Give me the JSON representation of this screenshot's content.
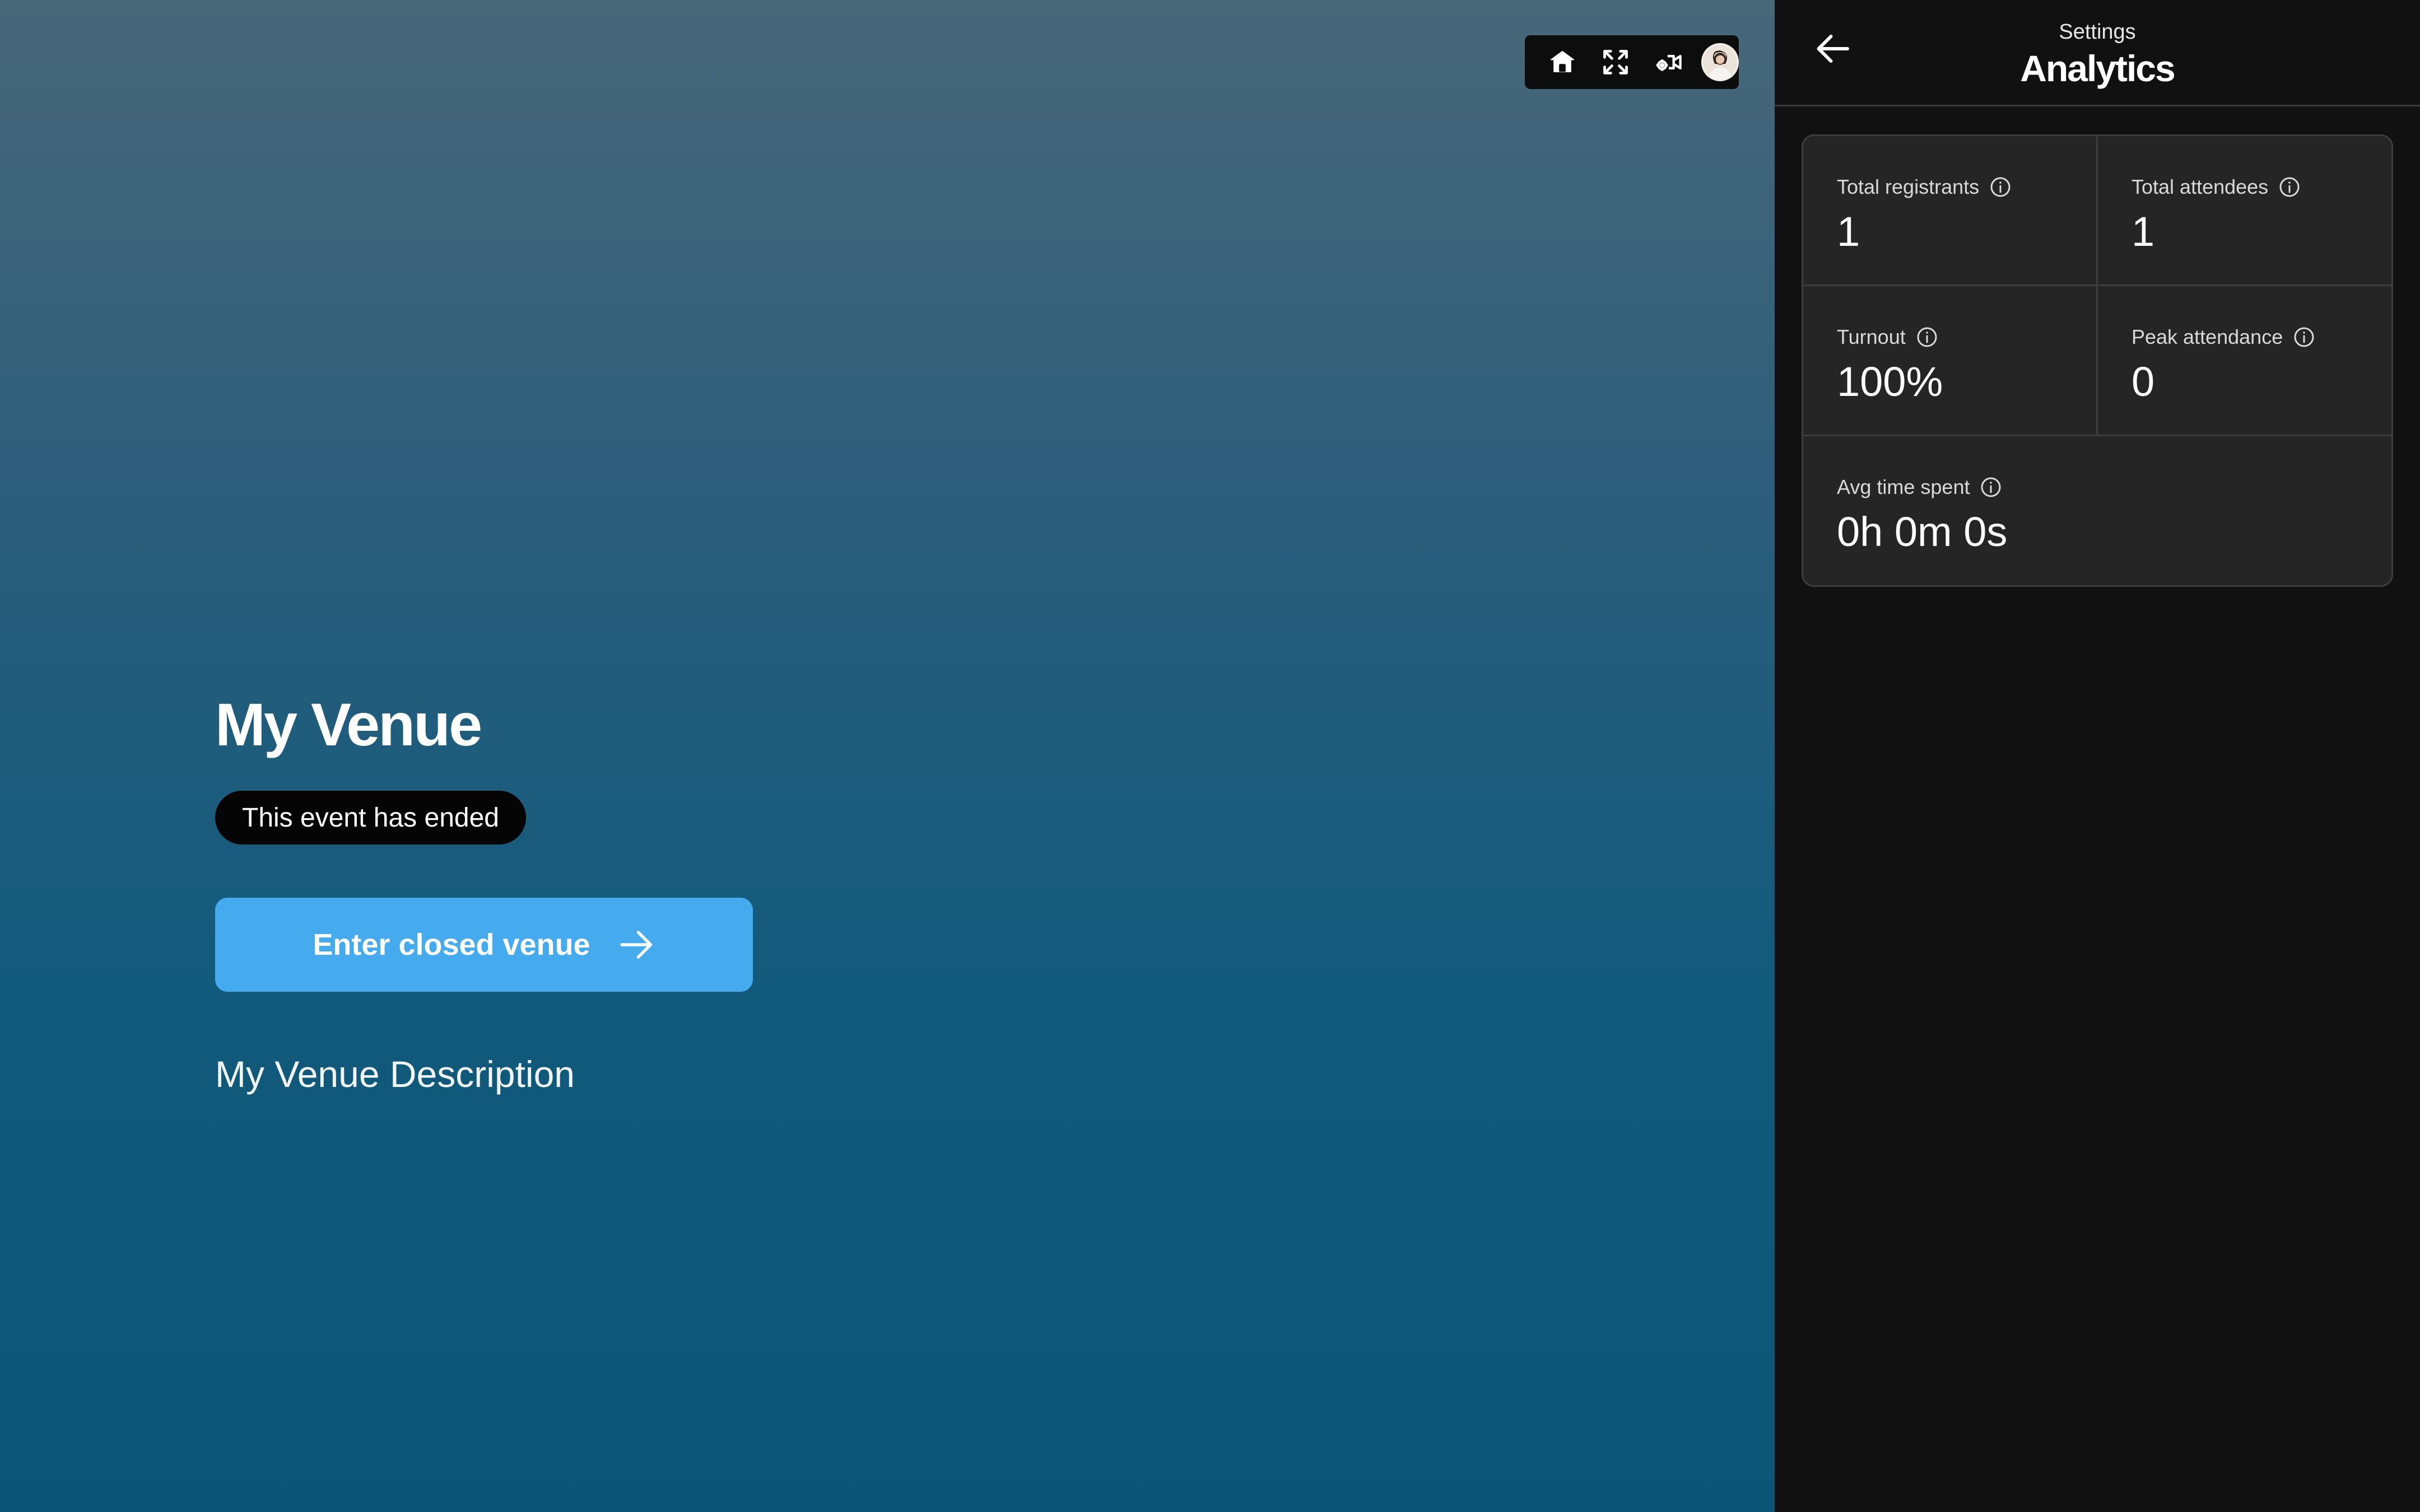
{
  "venue": {
    "title": "My Venue",
    "status_badge": "This event has ended",
    "enter_button_label": "Enter closed venue",
    "description": "My Venue Description"
  },
  "toolbar": {
    "icons": [
      "home-icon",
      "fullscreen-icon",
      "camera-settings-icon",
      "avatar"
    ]
  },
  "panel": {
    "subtitle": "Settings",
    "title": "Analytics",
    "stats": {
      "total_registrants": {
        "label": "Total registrants",
        "value": "1"
      },
      "total_attendees": {
        "label": "Total attendees",
        "value": "1"
      },
      "turnout": {
        "label": "Turnout",
        "value": "100%"
      },
      "peak_attendance": {
        "label": "Peak attendance",
        "value": "0"
      },
      "avg_time_spent": {
        "label": "Avg time spent",
        "value": "0h 0m 0s"
      }
    }
  },
  "colors": {
    "accent_button": "#45aaee",
    "panel_background": "#111111",
    "card_background": "#252525",
    "badge_background": "#050505"
  }
}
